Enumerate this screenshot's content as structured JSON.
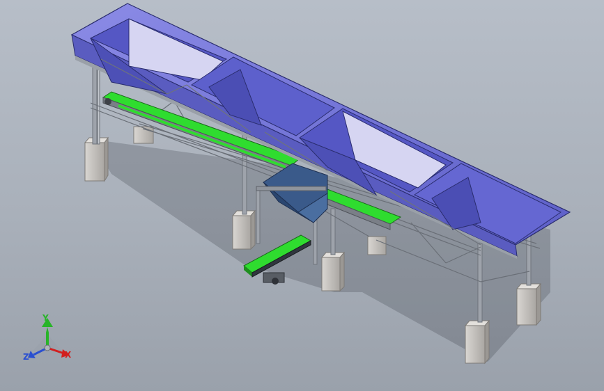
{
  "triad": {
    "x_label": "X",
    "y_label": "Y",
    "z_label": "Z",
    "x_color": "#d21f1f",
    "y_color": "#28b428",
    "z_color": "#2a4fd0"
  },
  "colors": {
    "hopper": "#6f6fd8",
    "hopper_dark": "#4f52b8",
    "hopper_light": "#cfcff2",
    "belt": "#33e033",
    "frame": "#8f949c",
    "pedestal": "#c9c6c2",
    "chute": "#3a5e8e"
  }
}
